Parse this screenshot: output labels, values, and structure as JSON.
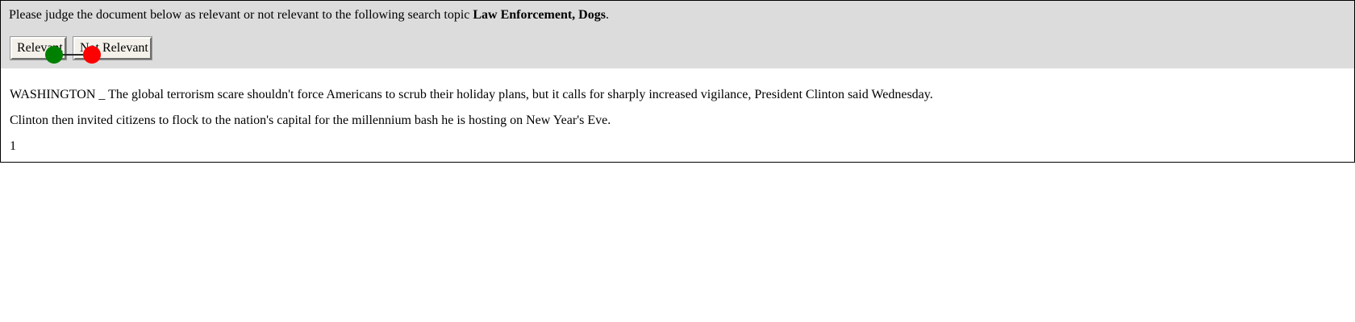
{
  "header": {
    "prompt_text": "Please judge the document below as relevant or not relevant to the following search topic ",
    "topic": "Law Enforcement, Dogs",
    "prompt_suffix": ".",
    "buttons": {
      "relevant_label": "Relevant",
      "not_relevant_label": "Not Relevant"
    },
    "markers": {
      "green_color": "#008000",
      "red_color": "#ff0000"
    }
  },
  "document": {
    "paragraphs": [
      "WASHINGTON _ The global terrorism scare shouldn't force Americans to scrub their holiday plans, but it calls for sharply increased vigilance, President Clinton said Wednesday.",
      "Clinton then invited citizens to flock to the nation's capital for the millennium bash he is hosting on New Year's Eve.",
      "1"
    ]
  },
  "colors": {
    "header_background": "#dcdcdc",
    "border": "#000000",
    "button_background": "#f4f1ea"
  }
}
